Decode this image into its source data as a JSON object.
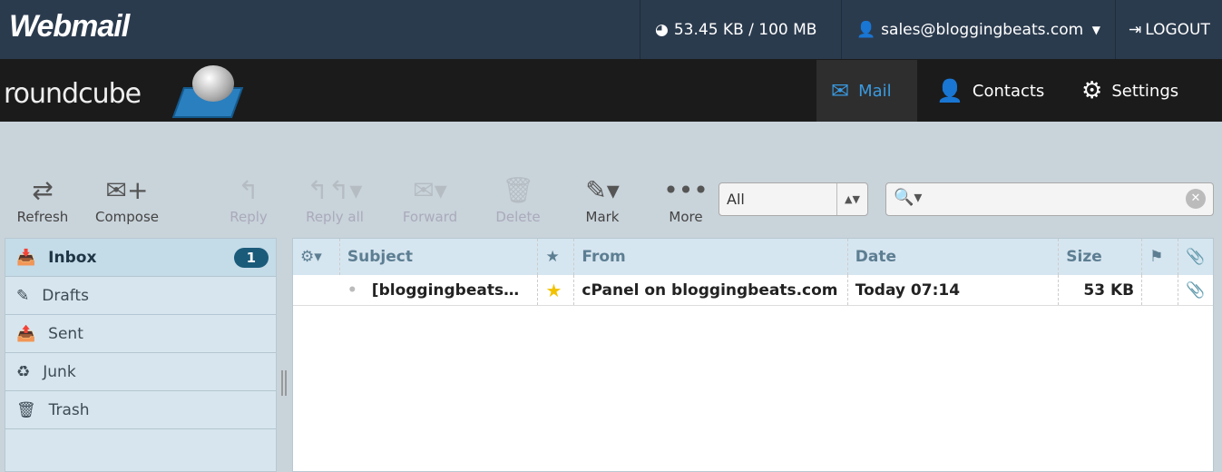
{
  "header": {
    "brand": "Webmail",
    "quota": "53.45 KB / 100 MB",
    "user": "sales@bloggingbeats.com",
    "logout": "LOGOUT"
  },
  "app": {
    "logo": "roundcube",
    "nav": [
      {
        "label": "Mail",
        "icon": "envelope-icon"
      },
      {
        "label": "Contacts",
        "icon": "person-icon"
      },
      {
        "label": "Settings",
        "icon": "gear-icon"
      }
    ]
  },
  "toolbar": {
    "refresh": "Refresh",
    "compose": "Compose",
    "reply": "Reply",
    "reply_all": "Reply all",
    "forward": "Forward",
    "delete": "Delete",
    "mark": "Mark",
    "more": "More",
    "filter": "All",
    "search_placeholder": ""
  },
  "folders": [
    {
      "label": "Inbox",
      "count": "1"
    },
    {
      "label": "Drafts"
    },
    {
      "label": "Sent"
    },
    {
      "label": "Junk"
    },
    {
      "label": "Trash"
    }
  ],
  "list": {
    "columns": {
      "subject": "Subject",
      "from": "From",
      "date": "Date",
      "size": "Size"
    },
    "rows": [
      {
        "subject": "[bloggingbeats…",
        "from": "cPanel on bloggingbeats.com",
        "date": "Today 07:14",
        "size": "53 KB",
        "flagged": true
      }
    ]
  },
  "colors": {
    "topbar": "#2b3b4e",
    "accent": "#3a9ae0",
    "star": "#f2c200"
  }
}
